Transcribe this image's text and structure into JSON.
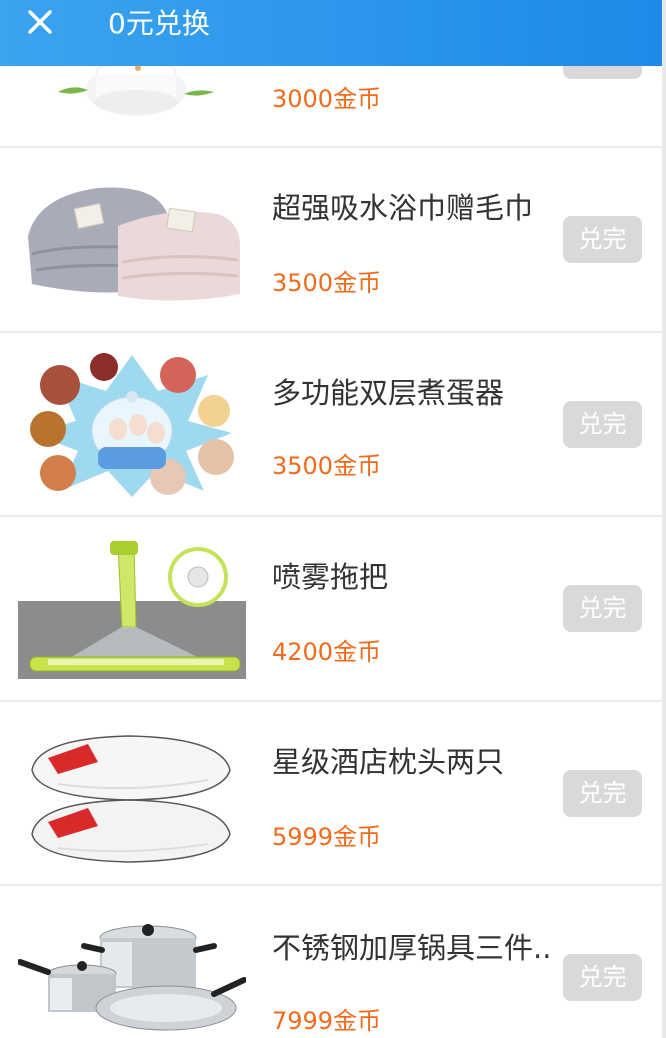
{
  "header": {
    "title": "0元兑换",
    "close_icon": "close-icon",
    "background": "#2293ea"
  },
  "items": [
    {
      "name": "",
      "price": "3000金币",
      "button": "兑完",
      "image": "humidifier-image"
    },
    {
      "name": "超强吸水浴巾赠毛巾",
      "price": "3500金币",
      "button": "兑完",
      "image": "towel-image"
    },
    {
      "name": "多功能双层煮蛋器",
      "price": "3500金币",
      "button": "兑完",
      "image": "egg-cooker-image"
    },
    {
      "name": "喷雾拖把",
      "price": "4200金币",
      "button": "兑完",
      "image": "spray-mop-image"
    },
    {
      "name": "星级酒店枕头两只",
      "price": "5999金币",
      "button": "兑完",
      "image": "pillow-image"
    },
    {
      "name": "不锈钢加厚锅具三件..",
      "price": "7999金币",
      "button": "兑完",
      "image": "cookware-image"
    }
  ],
  "colors": {
    "price": "#f26a1b",
    "button_disabled": "#d9d9d9"
  }
}
